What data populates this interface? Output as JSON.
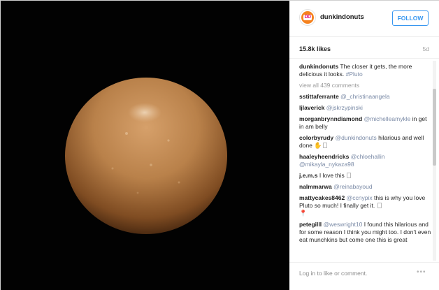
{
  "post": {
    "username": "dunkindonuts",
    "follow_label": "FOLLOW",
    "likes": "15.8k likes",
    "age": "5d",
    "caption_user": "dunkindonuts",
    "caption_text": "The closer it gets, the more delicious it looks.",
    "caption_tag": "#Pluto",
    "view_all": "view all 439 comments",
    "login_prompt": "Log in to like or comment.",
    "more_label": "•••"
  },
  "comments": [
    {
      "user": "sstittaferrante",
      "mention": "@_christinaangela",
      "text": ""
    },
    {
      "user": "ljlaverick",
      "mention": "@jskrzypinski",
      "text": ""
    },
    {
      "user": "morganbrynndiamond",
      "mention": "@michelleamykle",
      "text": "in get in am belly"
    },
    {
      "user": "colorbyrudy",
      "mention": "@dunkindonuts",
      "text": "hilarious and well done"
    },
    {
      "user": "haaleyheendricks",
      "mention": "@chloehallin",
      "text": "@mikayla_nykaza98"
    },
    {
      "user": "j.e.m.s",
      "mention": "",
      "text": "I love this"
    },
    {
      "user": "nalmmarwa",
      "mention": "@reinabayoud",
      "text": ""
    },
    {
      "user": "mattycakes8462",
      "mention": "@ccnypix",
      "text": "this is why you love Pluto so much! I finally get it."
    },
    {
      "user": "petegilll",
      "mention": "@weswright10",
      "text": "I found this hilarious and for some reason I think you might too. I don't even eat munchkins but come one this is great"
    }
  ],
  "icons": {
    "avatar": "dunkin-logo-icon",
    "more": "more-options-icon"
  },
  "colors": {
    "accent": "#3897f0",
    "photo_bg": "#020202",
    "donut_hole": "#b9814a"
  }
}
